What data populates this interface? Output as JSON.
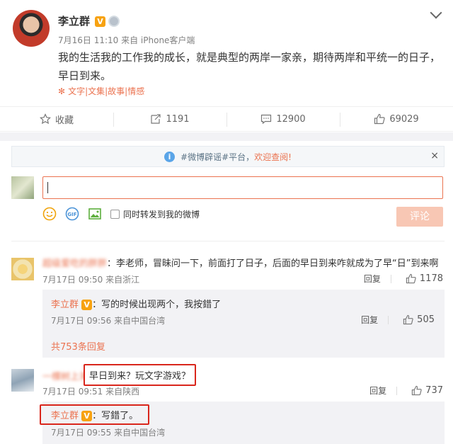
{
  "post": {
    "author": "李立群",
    "verified": "V",
    "time": "7月16日 11:10 来自 iPhone客户端",
    "text": "我的生活我的工作我的成长，就是典型的两岸一家亲，期待两岸和平统一的日子，早日到来。",
    "topics": "文字|文集|故事|情感"
  },
  "actions": {
    "favorite": "收藏",
    "repost_count": "1191",
    "comment_count": "12900",
    "like_count": "69029"
  },
  "notice": {
    "prefix": "#微博辟谣#平台，",
    "highlight": "欢迎查阅!",
    "close": "×"
  },
  "composer": {
    "repost_option": "同时转发到我的微博",
    "submit": "评论"
  },
  "comments": [
    {
      "user": "超级爱吃的胖胖",
      "text": "：李老师，冒昧问一下，前面打了日子，后面的早日到来咋就成为了早“日”到来啊",
      "meta": "7月17日 09:50 来自浙江",
      "reply": "回复",
      "likes": "1178",
      "replies": [
        {
          "user": "李立群",
          "text": "：写的时候出现两个，我按錯了",
          "meta": "7月17日 09:56 来自中国台湾",
          "reply": "回复",
          "likes": "505"
        }
      ],
      "more": "共753条回复"
    },
    {
      "user": "一棵树上海",
      "text": "早日到来？玩文字游戏？",
      "meta": "7月17日 09:51 来自陕西",
      "reply": "回复",
      "likes": "737",
      "replies": [
        {
          "user": "李立群",
          "text": "：写錯了。",
          "meta": "7月17日 09:55 来自中国台湾"
        }
      ]
    }
  ],
  "colors": {
    "accent": "#eb7350",
    "verified": "#f7a211",
    "highlight_border": "#d9261c"
  }
}
